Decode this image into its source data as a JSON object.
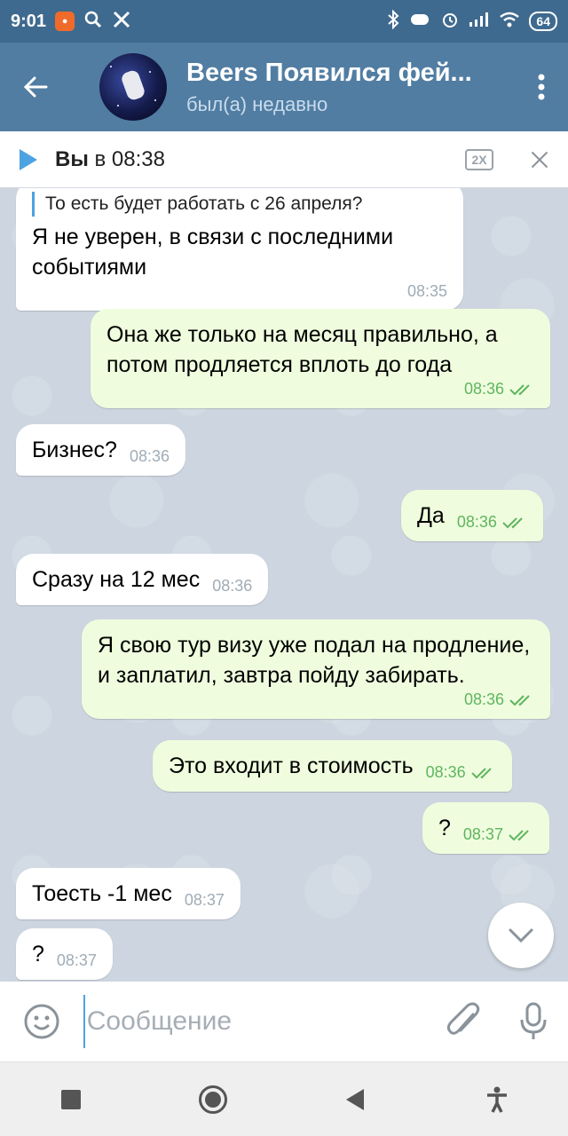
{
  "status_bar": {
    "time": "9:01",
    "battery": "64"
  },
  "header": {
    "title": "Beers Появился фей...",
    "status": "был(а) недавно"
  },
  "player": {
    "author": "Вы",
    "time_text": " в 08:38",
    "speed": "2X"
  },
  "messages": [
    {
      "dir": "in",
      "reply": "То есть будет работать с 26 апреля?",
      "text": "Я не уверен, в связи с последними событиями",
      "time": "08:35"
    },
    {
      "dir": "out",
      "text": "Она же только на месяц правильно, а потом продляется вплоть до года",
      "time": "08:36"
    },
    {
      "dir": "in",
      "text": "Бизнес?",
      "time": "08:36"
    },
    {
      "dir": "out",
      "text": "Да",
      "time": "08:36"
    },
    {
      "dir": "in",
      "text": "Сразу на 12 мес",
      "time": "08:36"
    },
    {
      "dir": "out",
      "text": "Я свою тур визу уже подал на продление, и заплатил, завтра пойду забирать.",
      "time": "08:36"
    },
    {
      "dir": "out",
      "text": "Это входит в стоимость",
      "time": "08:36"
    },
    {
      "dir": "out",
      "text": "?",
      "time": "08:37"
    },
    {
      "dir": "in",
      "text": "Тоесть -1 мес",
      "time": "08:37"
    },
    {
      "dir": "in",
      "text": "?",
      "time": "08:37"
    }
  ],
  "input": {
    "placeholder": "Сообщение"
  },
  "colors": {
    "header": "#517da2",
    "status_bar": "#3f6a8f",
    "outgoing_bubble": "#effdde",
    "incoming_bubble": "#ffffff",
    "accent": "#4da2e2",
    "chat_background": "#cdd6e0"
  },
  "icons": [
    "back-arrow-icon",
    "more-vert-icon",
    "play-icon",
    "close-icon",
    "emoji-icon",
    "attach-icon",
    "mic-icon",
    "chevron-down-icon",
    "double-check-icon"
  ]
}
